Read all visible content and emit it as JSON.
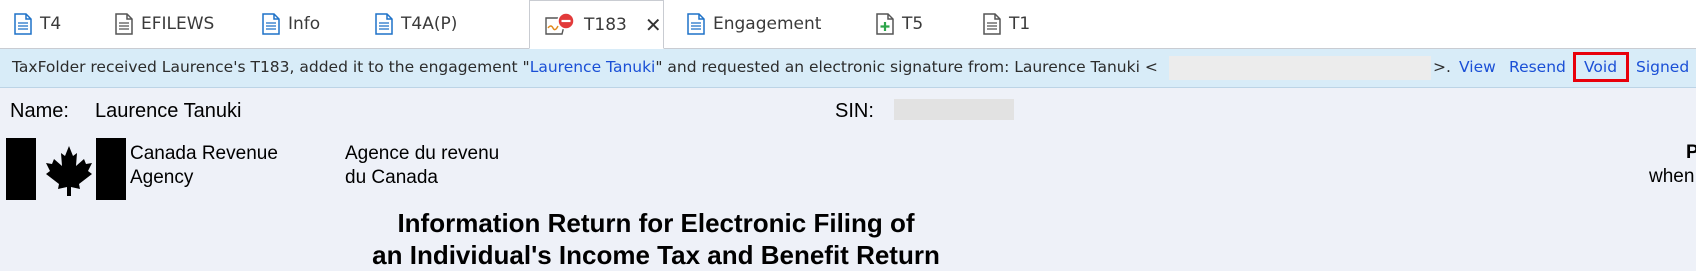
{
  "tabs": [
    {
      "label": "T4",
      "icon": "document-icon"
    },
    {
      "label": "EFILEWS",
      "icon": "document-icon"
    },
    {
      "label": "Info",
      "icon": "document-icon"
    },
    {
      "label": "T4A(P)",
      "icon": "document-icon"
    },
    {
      "label": "T183",
      "icon": "signature-pending-icon",
      "active": true,
      "close": "✕"
    },
    {
      "label": "Engagement",
      "icon": "document-icon"
    },
    {
      "label": "T5",
      "icon": "document-add-icon"
    },
    {
      "label": "T1",
      "icon": "document-icon"
    }
  ],
  "notification": {
    "text_before": "TaxFolder received Laurence's T183, added it to the engagement \"",
    "engagement_link": "Laurence Tanuki",
    "text_after": "\" and requested an electronic signature from: Laurence Tanuki <",
    "email_end": ">.",
    "actions": {
      "view": "View",
      "resend": "Resend",
      "void": "Void",
      "signed": "Signed"
    }
  },
  "form": {
    "name_label": "Name:",
    "name_value": "Laurence Tanuki",
    "sin_label": "SIN:",
    "agency_en_line1": "Canada Revenue",
    "agency_en_line2": "Agency",
    "agency_fr_line1": "Agence du revenu",
    "agency_fr_line2": "du Canada",
    "right_p": "P",
    "right_when": "when",
    "title_line1": "Information Return for Electronic Filing of",
    "title_line2": "an Individual's Income Tax and Benefit Return"
  },
  "colors": {
    "link": "#1a4fd6",
    "notify_bg": "#d8ecf8",
    "form_bg": "#eef1f8",
    "highlight": "#e8000b"
  }
}
